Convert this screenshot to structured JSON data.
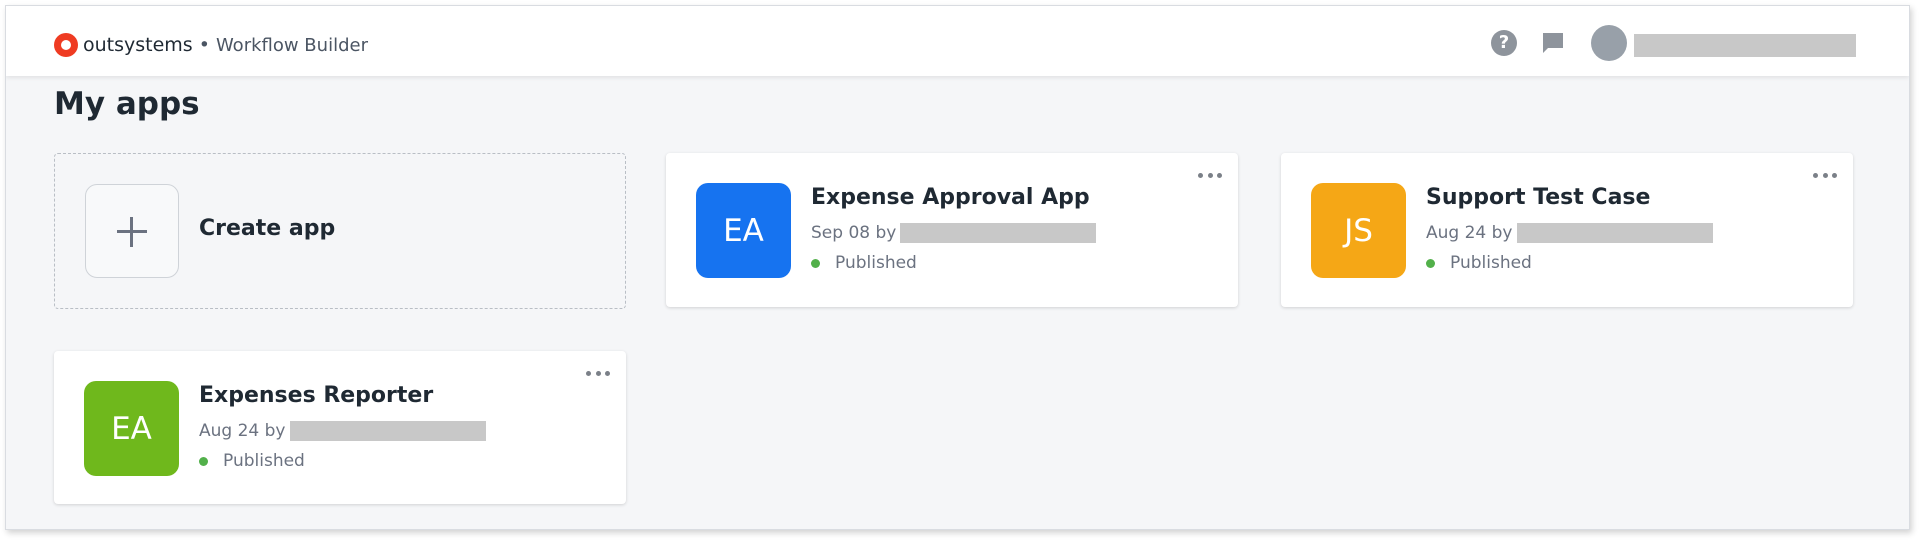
{
  "header": {
    "brand": "outsystems",
    "separator": "•",
    "product": "Workflow Builder",
    "help_icon": "help-circle-icon",
    "chat_icon": "chat-icon",
    "help_glyph": "?"
  },
  "page": {
    "title": "My apps"
  },
  "create": {
    "label": "Create app",
    "icon": "plus-icon"
  },
  "apps": [
    {
      "initials": "EA",
      "name": "Expense Approval App",
      "date": "Sep 08 by",
      "status": "Published",
      "color": "#1673f0"
    },
    {
      "initials": "JS",
      "name": "Support Test Case",
      "date": "Aug 24 by",
      "status": "Published",
      "color": "#f5a716"
    },
    {
      "initials": "EA",
      "name": "Expenses Reporter",
      "date": "Aug 24 by",
      "status": "Published",
      "color": "#6fb81c"
    }
  ],
  "colors": {
    "accent": "#ef3b22",
    "published": "#52b04a"
  }
}
